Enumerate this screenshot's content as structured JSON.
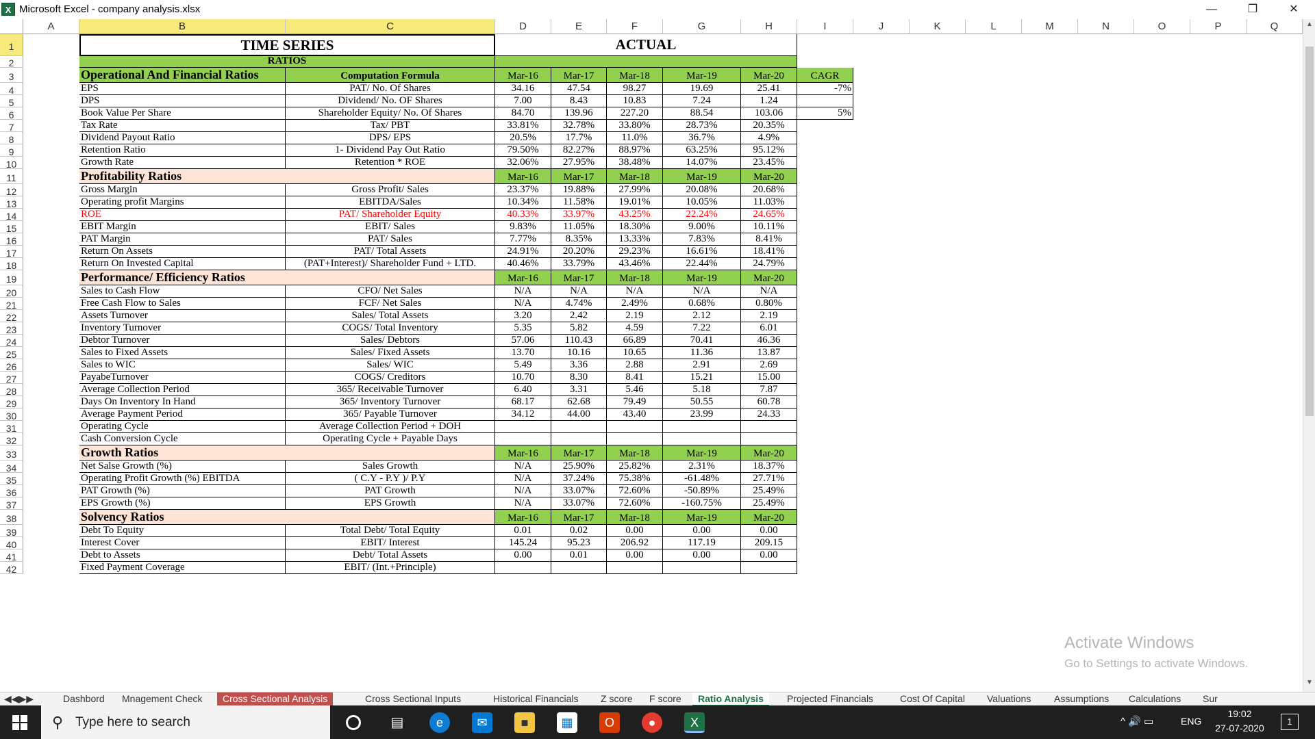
{
  "window": {
    "title": "Microsoft Excel - company analysis.xlsx"
  },
  "columns": [
    "A",
    "B",
    "C",
    "D",
    "E",
    "F",
    "G",
    "H",
    "I",
    "J",
    "K",
    "L",
    "M",
    "N",
    "O",
    "P",
    "Q"
  ],
  "rows": [
    "1",
    "2",
    "3",
    "4",
    "5",
    "6",
    "7",
    "8",
    "9",
    "10",
    "11",
    "12",
    "13",
    "14",
    "15",
    "16",
    "17",
    "18",
    "19",
    "20",
    "21",
    "22",
    "23",
    "24",
    "25",
    "26",
    "27",
    "28",
    "29",
    "30",
    "31",
    "32",
    "33",
    "34",
    "35",
    "36",
    "37",
    "38",
    "39",
    "40",
    "41",
    "42"
  ],
  "banner": {
    "time_series": "TIME SERIES",
    "actual": "ACTUAL",
    "ratios": "RATIOS"
  },
  "years": [
    "Mar-16",
    "Mar-17",
    "Mar-18",
    "Mar-19",
    "Mar-20"
  ],
  "cagr": {
    "label": "CAGR",
    "eps": "-7%",
    "bvps": "5%"
  },
  "sections": [
    {
      "title": "Operational And Financial Ratios",
      "formula_header": "Computation Formula",
      "rows": [
        {
          "label": "EPS",
          "formula": "PAT/ No. Of Shares",
          "values": [
            "34.16",
            "47.54",
            "98.27",
            "19.69",
            "25.41"
          ]
        },
        {
          "label": "DPS",
          "formula": "Dividend/ No. OF Shares",
          "values": [
            "7.00",
            "8.43",
            "10.83",
            "7.24",
            "1.24"
          ]
        },
        {
          "label": "Book Value Per Share",
          "formula": "Shareholder Equity/ No. Of Shares",
          "values": [
            "84.70",
            "139.96",
            "227.20",
            "88.54",
            "103.06"
          ]
        },
        {
          "label": "Tax Rate",
          "formula": "Tax/ PBT",
          "values": [
            "33.81%",
            "32.78%",
            "33.80%",
            "28.73%",
            "20.35%"
          ]
        },
        {
          "label": "Dividend Payout Ratio",
          "formula": "DPS/ EPS",
          "values": [
            "20.5%",
            "17.7%",
            "11.0%",
            "36.7%",
            "4.9%"
          ]
        },
        {
          "label": "Retention Ratio",
          "formula": "1- Dividend Pay Out Ratio",
          "values": [
            "79.50%",
            "82.27%",
            "88.97%",
            "63.25%",
            "95.12%"
          ]
        },
        {
          "label": "Growth Rate",
          "formula": "Retention * ROE",
          "values": [
            "32.06%",
            "27.95%",
            "38.48%",
            "14.07%",
            "23.45%"
          ]
        }
      ]
    },
    {
      "title": "Profitability Ratios",
      "formula_header": "",
      "rows": [
        {
          "label": "Gross Margin",
          "formula": "Gross Profit/ Sales",
          "values": [
            "23.37%",
            "19.88%",
            "27.99%",
            "20.08%",
            "20.68%"
          ]
        },
        {
          "label": "Operating profit Margins",
          "formula": "EBITDA/Sales",
          "values": [
            "10.34%",
            "11.58%",
            "19.01%",
            "10.05%",
            "11.03%"
          ]
        },
        {
          "label": "ROE",
          "formula": "PAT/ Shareholder Equity",
          "values": [
            "40.33%",
            "33.97%",
            "43.25%",
            "22.24%",
            "24.65%"
          ],
          "highlight": true
        },
        {
          "label": "EBIT Margin",
          "formula": "EBIT/ Sales",
          "values": [
            "9.83%",
            "11.05%",
            "18.30%",
            "9.00%",
            "10.11%"
          ]
        },
        {
          "label": "PAT Margin",
          "formula": "PAT/ Sales",
          "values": [
            "7.77%",
            "8.35%",
            "13.33%",
            "7.83%",
            "8.41%"
          ]
        },
        {
          "label": "Return On Assets",
          "formula": "PAT/ Total Assets",
          "values": [
            "24.91%",
            "20.20%",
            "29.23%",
            "16.61%",
            "18.41%"
          ]
        },
        {
          "label": "Return On Invested Capital",
          "formula": "(PAT+Interest)/ Shareholder Fund + LTD.",
          "values": [
            "40.46%",
            "33.79%",
            "43.46%",
            "22.44%",
            "24.79%"
          ]
        }
      ]
    },
    {
      "title": "Performance/ Efficiency Ratios",
      "formula_header": "",
      "rows": [
        {
          "label": "Sales to Cash Flow",
          "formula": "CFO/ Net Sales",
          "values": [
            "N/A",
            "N/A",
            "N/A",
            "N/A",
            "N/A"
          ]
        },
        {
          "label": "Free Cash Flow to Sales",
          "formula": "FCF/ Net Sales",
          "values": [
            "N/A",
            "4.74%",
            "2.49%",
            "0.68%",
            "0.80%"
          ]
        },
        {
          "label": "Assets Turnover",
          "formula": "Sales/ Total Assets",
          "values": [
            "3.20",
            "2.42",
            "2.19",
            "2.12",
            "2.19"
          ]
        },
        {
          "label": "Inventory Turnover",
          "formula": "COGS/ Total Inventory",
          "values": [
            "5.35",
            "5.82",
            "4.59",
            "7.22",
            "6.01"
          ]
        },
        {
          "label": "Debtor Turnover",
          "formula": "Sales/ Debtors",
          "values": [
            "57.06",
            "110.43",
            "66.89",
            "70.41",
            "46.36"
          ]
        },
        {
          "label": "Sales to Fixed Assets",
          "formula": "Sales/ Fixed Assets",
          "values": [
            "13.70",
            "10.16",
            "10.65",
            "11.36",
            "13.87"
          ]
        },
        {
          "label": "Sales to WIC",
          "formula": "Sales/ WIC",
          "values": [
            "5.49",
            "3.36",
            "2.88",
            "2.91",
            "2.69"
          ]
        },
        {
          "label": "PayabeTurnover",
          "formula": "COGS/ Creditors",
          "values": [
            "10.70",
            "8.30",
            "8.41",
            "15.21",
            "15.00"
          ]
        },
        {
          "label": "Average Collection Period",
          "formula": "365/ Receivable Turnover",
          "values": [
            "6.40",
            "3.31",
            "5.46",
            "5.18",
            "7.87"
          ]
        },
        {
          "label": "Days On Inventory In Hand",
          "formula": "365/ Inventory Turnover",
          "values": [
            "68.17",
            "62.68",
            "79.49",
            "50.55",
            "60.78"
          ]
        },
        {
          "label": "Average Payment Period",
          "formula": "365/ Payable Turnover",
          "values": [
            "34.12",
            "44.00",
            "43.40",
            "23.99",
            "24.33"
          ]
        },
        {
          "label": "Operating Cycle",
          "formula": "Average Collection Period + DOH",
          "values": [
            "",
            "",
            "",
            "",
            ""
          ]
        },
        {
          "label": "Cash Conversion Cycle",
          "formula": "Operating Cycle + Payable Days",
          "values": [
            "",
            "",
            "",
            "",
            ""
          ]
        }
      ]
    },
    {
      "title": "Growth Ratios",
      "formula_header": "",
      "rows": [
        {
          "label": "Net Salse Growth (%)",
          "formula": "Sales Growth",
          "values": [
            "N/A",
            "25.90%",
            "25.82%",
            "2.31%",
            "18.37%"
          ]
        },
        {
          "label": "Operating Profit Growth (%) EBITDA",
          "formula": "( C.Y - P.Y )/ P.Y",
          "values": [
            "N/A",
            "37.24%",
            "75.38%",
            "-61.48%",
            "27.71%"
          ]
        },
        {
          "label": "PAT Growth (%)",
          "formula": "PAT Growth",
          "values": [
            "N/A",
            "33.07%",
            "72.60%",
            "-50.89%",
            "25.49%"
          ]
        },
        {
          "label": "EPS Growth (%)",
          "formula": "EPS Growth",
          "values": [
            "N/A",
            "33.07%",
            "72.60%",
            "-160.75%",
            "25.49%"
          ]
        }
      ]
    },
    {
      "title": "Solvency Ratios",
      "formula_header": "",
      "rows": [
        {
          "label": "Debt To Equity",
          "formula": "Total Debt/ Total Equity",
          "values": [
            "0.01",
            "0.02",
            "0.00",
            "0.00",
            "0.00"
          ]
        },
        {
          "label": "Interest Cover",
          "formula": "EBIT/ Interest",
          "values": [
            "145.24",
            "95.23",
            "206.92",
            "117.19",
            "209.15"
          ]
        },
        {
          "label": "Debt to Assets",
          "formula": "Debt/ Total Assets",
          "values": [
            "0.00",
            "0.01",
            "0.00",
            "0.00",
            "0.00"
          ]
        },
        {
          "label": "Fixed Payment Coverage",
          "formula": "EBIT/ (Int.+Principle)",
          "values": [
            "",
            "",
            "",
            "",
            ""
          ]
        }
      ]
    }
  ],
  "tabs": [
    {
      "label": "Dashbord"
    },
    {
      "label": "Mnagement Check"
    },
    {
      "label": "Cross Sectional Analysis",
      "style": "red"
    },
    {
      "label": "Cross Sectional Inputs"
    },
    {
      "label": "Historical Financials"
    },
    {
      "label": "Z score"
    },
    {
      "label": "F score"
    },
    {
      "label": "Ratio Analysis",
      "style": "active"
    },
    {
      "label": "Projected Financials"
    },
    {
      "label": "Cost Of Capital"
    },
    {
      "label": "Valuations"
    },
    {
      "label": "Assumptions"
    },
    {
      "label": "Calculations"
    },
    {
      "label": "Sur"
    }
  ],
  "watermark": {
    "title": "Activate Windows",
    "subtitle": "Go to Settings to activate Windows."
  },
  "taskbar": {
    "search_placeholder": "Type here to search",
    "language": "ENG",
    "time": "19:02",
    "date": "27-07-2020",
    "notifications": "1"
  },
  "colors": {
    "green": "#92d050",
    "peach": "#fce4d6",
    "red": "#ff0000",
    "excel": "#1e7145"
  }
}
